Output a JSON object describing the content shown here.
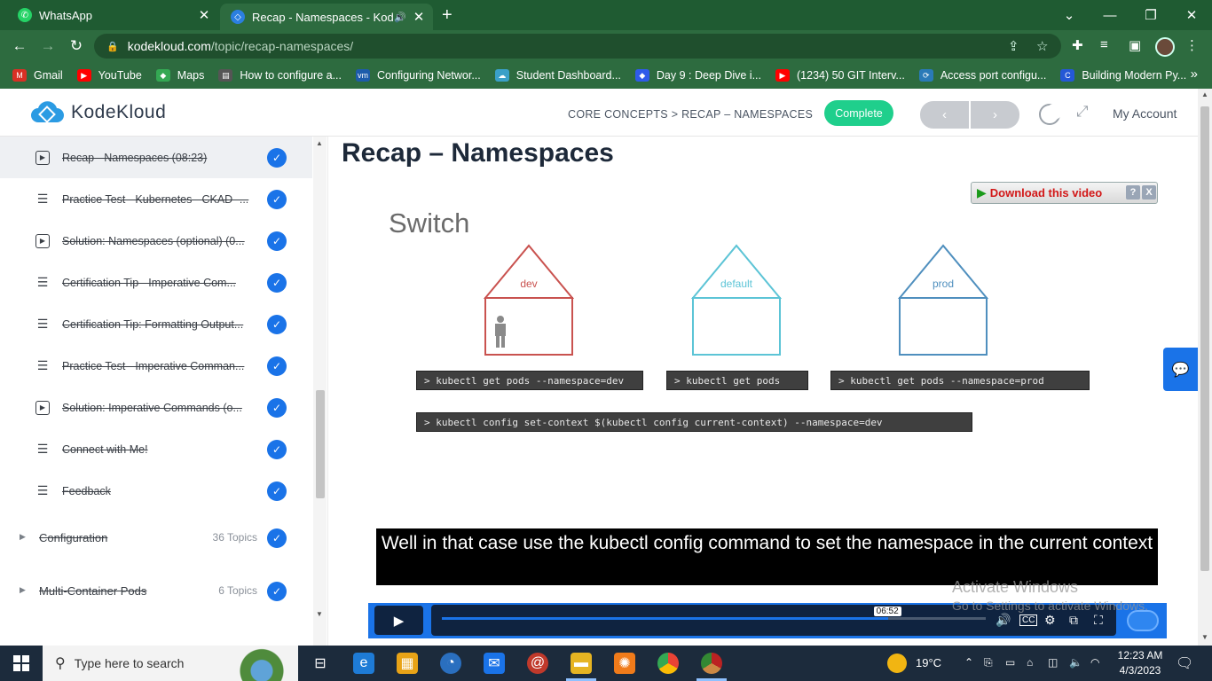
{
  "browser": {
    "tabs": [
      {
        "title": "WhatsApp",
        "active": false
      },
      {
        "title": "Recap - Namespaces - KodeK",
        "active": true
      }
    ],
    "url_domain": "kodekloud.com",
    "url_path": "/topic/recap-namespaces/",
    "bookmarks": [
      {
        "label": "Gmail",
        "icon": "gmail-icon",
        "color": "#d93025"
      },
      {
        "label": "YouTube",
        "icon": "youtube-icon",
        "color": "#ff0000"
      },
      {
        "label": "Maps",
        "icon": "maps-icon",
        "color": "#34a853"
      },
      {
        "label": "How to configure a...",
        "icon": "page-icon",
        "color": "#555555"
      },
      {
        "label": "Configuring Networ...",
        "icon": "vmware-icon",
        "color": "#1d5cab"
      },
      {
        "label": "Student Dashboard...",
        "icon": "cloud-icon",
        "color": "#3aa0c8"
      },
      {
        "label": "Day 9 : Deep Dive i...",
        "icon": "diamond-icon",
        "color": "#2f5bea"
      },
      {
        "label": "(1234) 50 GIT Interv...",
        "icon": "youtube-icon",
        "color": "#ff0000"
      },
      {
        "label": "Access port configu...",
        "icon": "link-icon",
        "color": "#2a7ab8"
      },
      {
        "label": "Building Modern Py...",
        "icon": "c-icon",
        "color": "#2458d6"
      }
    ]
  },
  "header": {
    "logo_text": "KodeKloud",
    "breadcrumb": "CORE CONCEPTS > RECAP – NAMESPACES",
    "complete_label": "Complete",
    "prev_icon": "‹",
    "next_icon": "›",
    "account_label": "My Account"
  },
  "sidebar": {
    "lessons": [
      {
        "title": "Recap - Namespaces (08:23)",
        "type": "video",
        "current": true
      },
      {
        "title": "Practice Test - Kubernetes - CKAD -...",
        "type": "text",
        "current": false
      },
      {
        "title": "Solution: Namespaces (optional) (0...",
        "type": "video",
        "current": false
      },
      {
        "title": "Certification Tip - Imperative Com...",
        "type": "text",
        "current": false
      },
      {
        "title": "Certification Tip: Formatting Output...",
        "type": "text",
        "current": false
      },
      {
        "title": "Practice Test - Imperative Comman...",
        "type": "text",
        "current": false
      },
      {
        "title": "Solution: Imperative Commands (o...",
        "type": "video",
        "current": false
      },
      {
        "title": "Connect with Me!",
        "type": "text",
        "current": false
      },
      {
        "title": "Feedback",
        "type": "text",
        "current": false
      }
    ],
    "sections": [
      {
        "title": "Configuration",
        "count": "36 Topics"
      },
      {
        "title": "Multi-Container Pods",
        "count": "6 Topics"
      }
    ]
  },
  "main": {
    "title": "Recap – Namespaces",
    "download_label": "Download this video",
    "download_help": "?",
    "download_close": "X",
    "slide": {
      "heading": "Switch",
      "houses": [
        {
          "label": "dev",
          "color": "#c9524f"
        },
        {
          "label": "default",
          "color": "#5cc4d6"
        },
        {
          "label": "prod",
          "color": "#4f8fbe"
        }
      ],
      "commands": [
        "> kubectl get pods --namespace=dev",
        "> kubectl get pods",
        "> kubectl get pods --namespace=prod",
        "> kubectl config set-context $(kubectl config current-context) --namespace=dev"
      ]
    },
    "caption": "Well in that case use the kubectl config command to set the namespace in the current context",
    "player": {
      "time": "06:52",
      "progress": 0.82
    }
  },
  "watermark": {
    "line1": "Activate Windows",
    "line2": "Go to Settings to activate Windows."
  },
  "taskbar": {
    "search_placeholder": "Type here to search",
    "weather": "19°C",
    "time": "12:23 AM",
    "date": "4/3/2023"
  }
}
